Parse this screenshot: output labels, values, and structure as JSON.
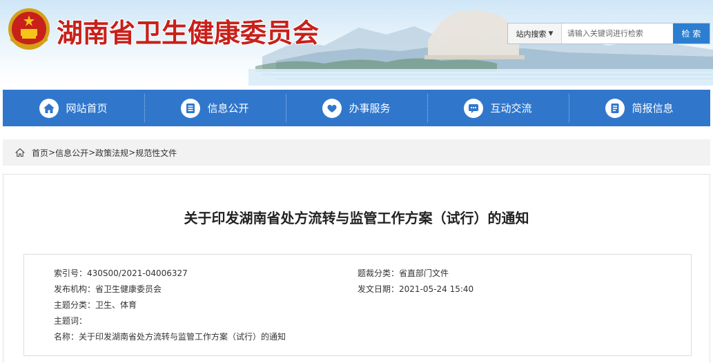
{
  "site": {
    "title": "湖南省卫生健康委员会"
  },
  "search": {
    "scope_label": "站内搜索",
    "placeholder": "请输入关键词进行检索",
    "button_label": "检 索"
  },
  "nav": {
    "items": [
      {
        "label": "网站首页",
        "icon": "home-icon"
      },
      {
        "label": "信息公开",
        "icon": "info-list-icon"
      },
      {
        "label": "办事服务",
        "icon": "service-heart-icon"
      },
      {
        "label": "互动交流",
        "icon": "chat-icon"
      },
      {
        "label": "简报信息",
        "icon": "bulletin-icon"
      }
    ]
  },
  "breadcrumb": {
    "items": [
      "首页",
      "信息公开",
      "政策法规",
      "规范性文件"
    ],
    "separator": ">"
  },
  "article": {
    "title": "关于印发湖南省处方流转与监管工作方案（试行）的通知",
    "meta": {
      "index_no_label": "索引号：",
      "index_no": "430S00/2021-04006327",
      "category_label": "题裁分类：",
      "category": "省直部门文件",
      "issuer_label": "发布机构：",
      "issuer": "省卫生健康委员会",
      "date_label": "发文日期：",
      "date": "2021-05-24 15:40",
      "subject_label": "主题分类：",
      "subject": "卫生、体育",
      "keywords_label": "主题词：",
      "keywords": "",
      "name_label": "名称：",
      "name": "关于印发湖南省处方流转与监管工作方案（试行）的通知"
    }
  },
  "colors": {
    "nav_bg": "#3077cc",
    "title_red": "#c8201b",
    "search_button": "#2c7fd0"
  }
}
